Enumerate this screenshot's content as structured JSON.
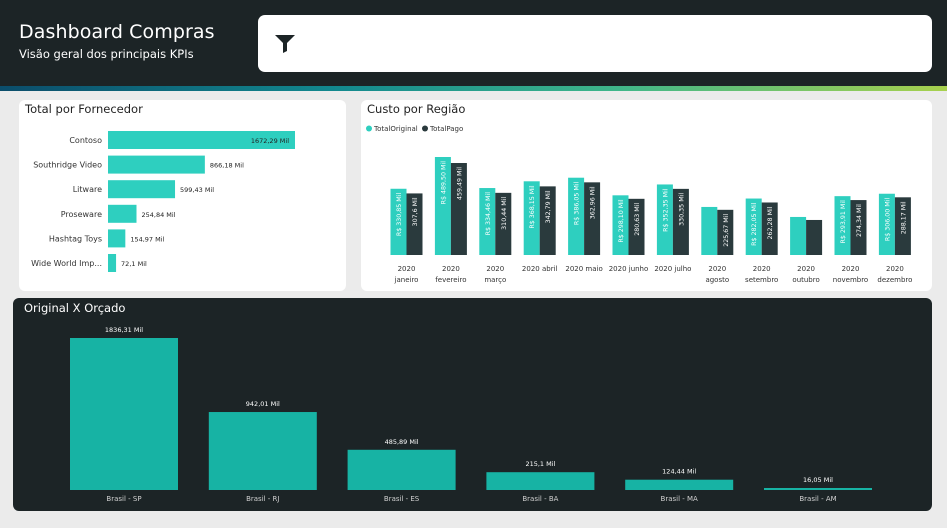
{
  "header": {
    "title": "Dashboard Compras",
    "subtitle": "Visão geral dos principais KPIs",
    "filter_icon": "filter-icon"
  },
  "colors": {
    "header_bg": "#1c2426",
    "teal": "#2ecfbf",
    "teal_dark": "#17b3a4",
    "dark_bar": "#2a3a3d",
    "card_bg": "#ffffff",
    "page_bg": "#ebebeb"
  },
  "fornecedor": {
    "title": "Total por Fornecedor",
    "chart_data": {
      "type": "bar",
      "orientation": "horizontal",
      "categories": [
        "Contoso",
        "Southridge Video",
        "Litware",
        "Proseware",
        "Hashtag Toys",
        "Wide World Imp..."
      ],
      "values": [
        1672.29,
        866.18,
        599.43,
        254.84,
        154.97,
        72.1
      ],
      "labels": [
        "1672,29 Mil",
        "866,18 Mil",
        "599,43 Mil",
        "254,84 Mil",
        "154,97 Mil",
        "72,1 Mil"
      ]
    }
  },
  "regiao": {
    "title": "Custo por Região",
    "chart_data": {
      "type": "bar",
      "categories": [
        [
          "2020",
          "janeiro"
        ],
        [
          "2020",
          "fevereiro"
        ],
        [
          "2020",
          "março"
        ],
        [
          "2020 abril"
        ],
        [
          "2020 maio"
        ],
        [
          "2020 junho"
        ],
        [
          "2020 julho"
        ],
        [
          "2020",
          "agosto"
        ],
        [
          "2020",
          "setembro"
        ],
        [
          "2020",
          "outubro"
        ],
        [
          "2020",
          "novembro"
        ],
        [
          "2020",
          "dezembro"
        ]
      ],
      "legend": [
        "TotalOriginal",
        "TotalPago"
      ],
      "series": [
        {
          "name": "TotalOriginal",
          "values": [
            330.85,
            489.5,
            334.46,
            368.15,
            386.05,
            298.1,
            352.35,
            240,
            282.05,
            190,
            293.91,
            306.0
          ],
          "labels": [
            "R$ 330,85 Mil",
            "R$ 489,50 Mil",
            "R$ 334,46 Mil",
            "R$ 368,15 Mil",
            "R$ 386,05 Mil",
            "R$ 298,10 Mil",
            "R$ 352,35 Mil",
            "",
            "R$ 282,05 Mil",
            "",
            "R$ 293,91 Mil",
            "R$ 306,00 Mil"
          ]
        },
        {
          "name": "TotalPago",
          "values": [
            307.6,
            459.49,
            310.44,
            342.79,
            362.96,
            280.63,
            330.35,
            225.67,
            262.28,
            175,
            274.34,
            288.17
          ],
          "labels": [
            "307,6 Mil",
            "459,49 Mil",
            "310,44 Mil",
            "342,79 Mil",
            "362,96 Mil",
            "280,63 Mil",
            "330,35 Mil",
            "225,67 Mil",
            "262,28 Mil",
            "",
            "274,34 Mil",
            "288,17 Mil"
          ]
        }
      ]
    }
  },
  "orcado": {
    "title": "Original X Orçado",
    "chart_data": {
      "type": "bar",
      "categories": [
        "Brasil - SP",
        "Brasil - RJ",
        "Brasil - ES",
        "Brasil - BA",
        "Brasil - MA",
        "Brasil - AM"
      ],
      "values": [
        1836.31,
        942.01,
        485.89,
        215.1,
        124.44,
        16.05
      ],
      "labels": [
        "1836,31 Mil",
        "942,01 Mil",
        "485,89 Mil",
        "215,1 Mil",
        "124,44 Mil",
        "16,05 Mil"
      ]
    }
  }
}
